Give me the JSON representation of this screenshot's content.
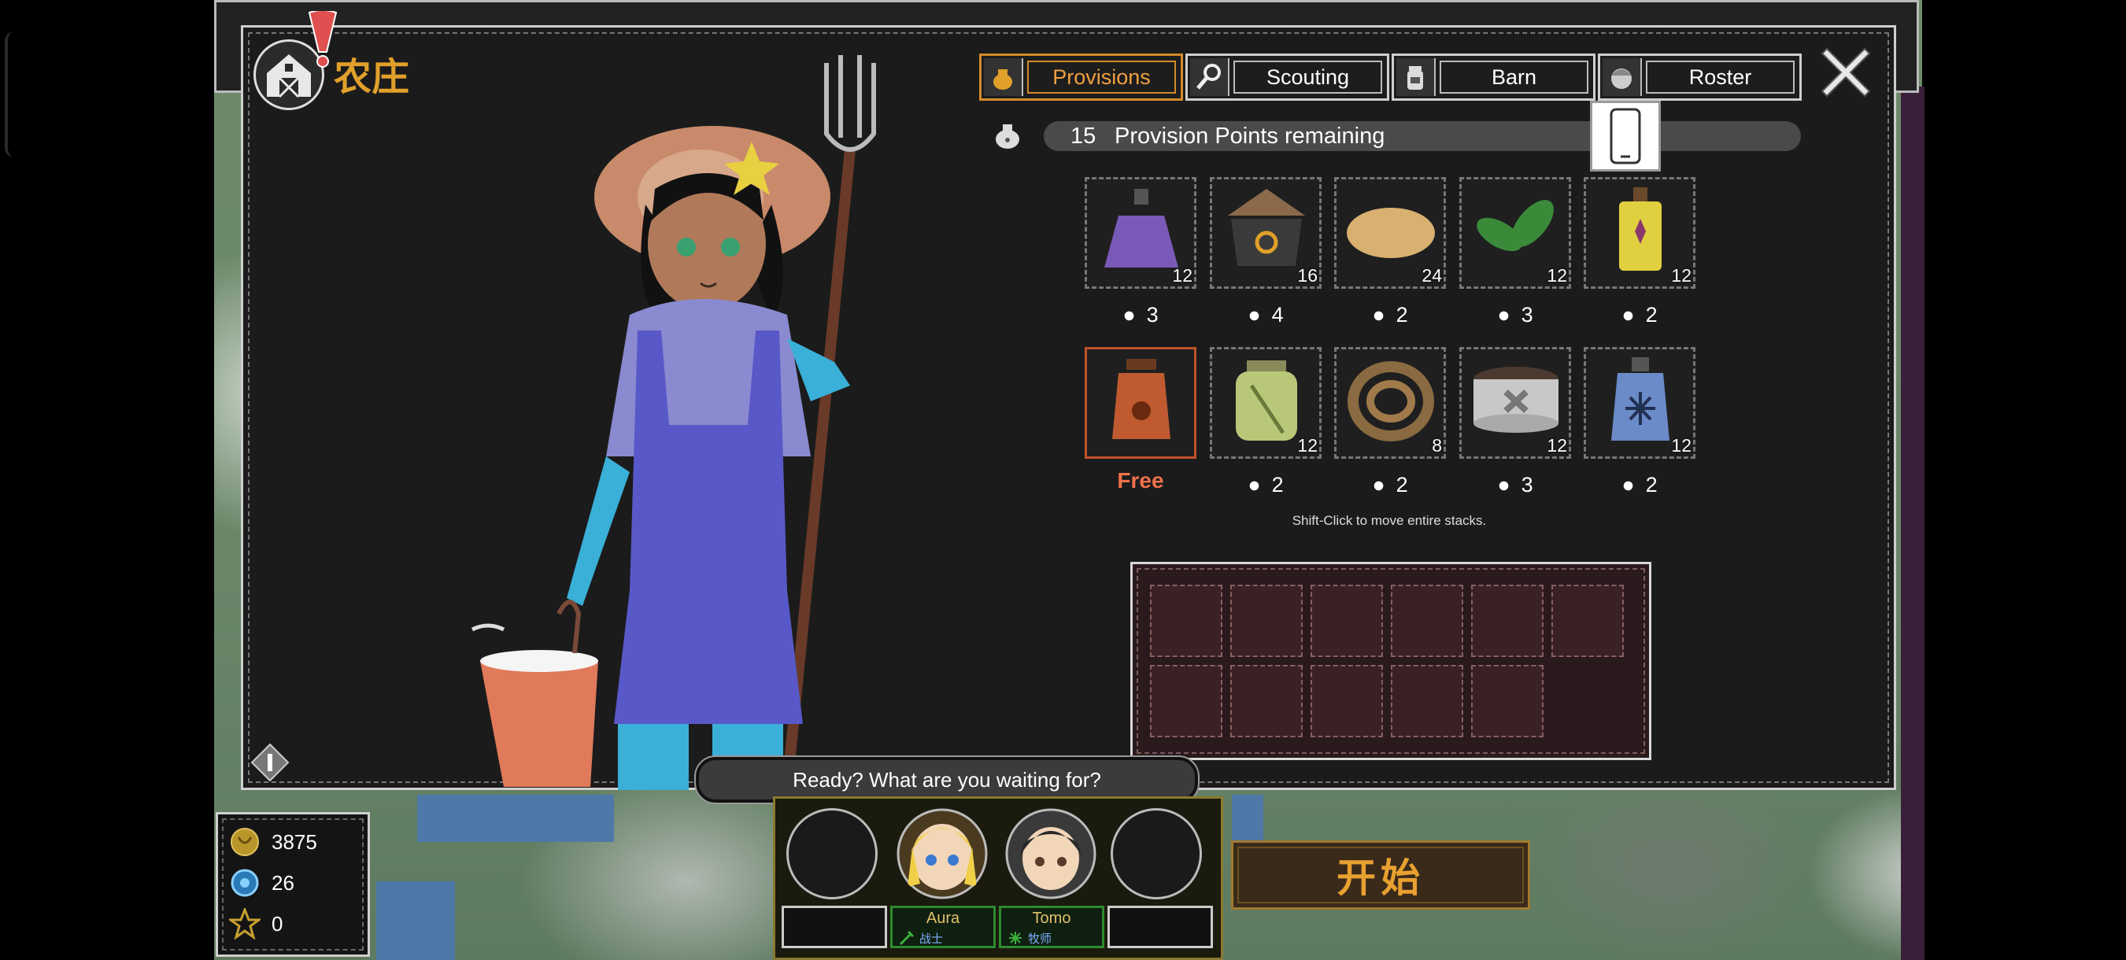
{
  "title": "农庄",
  "tabs": [
    {
      "label": "Provisions",
      "icon": "bag-icon",
      "active": true
    },
    {
      "label": "Scouting",
      "icon": "magnifier-icon",
      "active": false
    },
    {
      "label": "Barn",
      "icon": "jar-icon",
      "active": false
    },
    {
      "label": "Roster",
      "icon": "face-icon",
      "active": false
    }
  ],
  "provision": {
    "points": "15",
    "label": "Provision Points remaining"
  },
  "items_row1": [
    {
      "icon": "purple-potion-icon",
      "count": "12",
      "cost": "3"
    },
    {
      "icon": "stew-pot-icon",
      "count": "16",
      "cost": "4"
    },
    {
      "icon": "bread-icon",
      "count": "24",
      "cost": "2"
    },
    {
      "icon": "herb-leaves-icon",
      "count": "12",
      "cost": "3"
    },
    {
      "icon": "yellow-flask-icon",
      "count": "12",
      "cost": "2"
    }
  ],
  "items_row2": [
    {
      "icon": "milk-churn-icon",
      "count": "",
      "cost": "Free"
    },
    {
      "icon": "green-jar-icon",
      "count": "12",
      "cost": "2"
    },
    {
      "icon": "rope-coil-icon",
      "count": "8",
      "cost": "2"
    },
    {
      "icon": "bandage-icon",
      "count": "12",
      "cost": "3"
    },
    {
      "icon": "frost-bottle-icon",
      "count": "12",
      "cost": "2"
    }
  ],
  "hint": "Shift-Click to move entire stacks.",
  "dialogue": "Ready? What are you waiting for?",
  "stats": [
    {
      "icon": "gold-coin-icon",
      "value": "3875"
    },
    {
      "icon": "blue-gem-icon",
      "value": "26"
    },
    {
      "icon": "gold-star-icon",
      "value": "0"
    }
  ],
  "party": [
    {
      "name": "",
      "class": ""
    },
    {
      "name": "Aura",
      "class": "战士"
    },
    {
      "name": "Tomo",
      "class": "牧师"
    },
    {
      "name": "",
      "class": ""
    }
  ],
  "start_label": "开始",
  "colors": {
    "accent": "#e0a02a",
    "panel": "#1b1b1b",
    "free": "#f0704a",
    "hero_border": "#2e8a2e"
  }
}
